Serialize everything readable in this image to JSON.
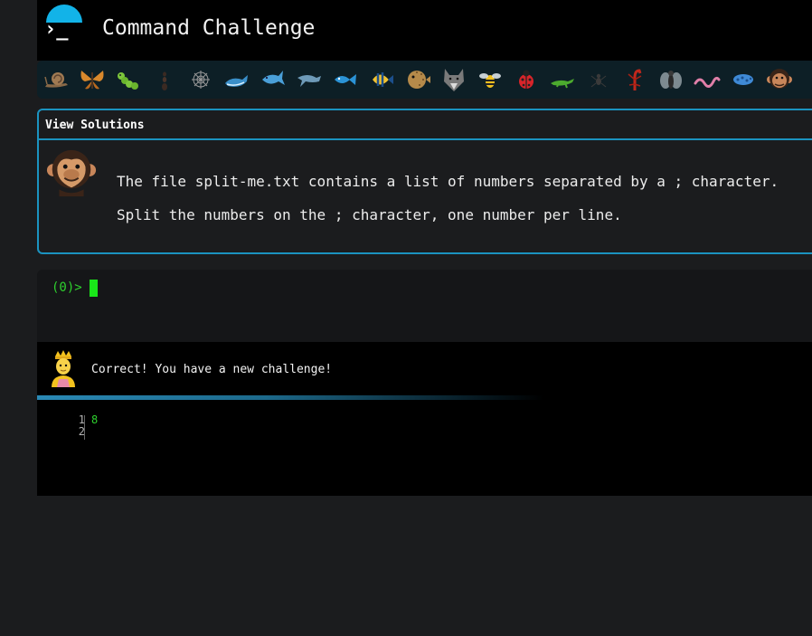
{
  "app": {
    "title": "Command Challenge",
    "logo_glyph": "›_",
    "accent_color": "#1b93c0"
  },
  "animal_bar": {
    "icons": [
      "snail",
      "butterfly",
      "caterpillar",
      "ant",
      "spider-web",
      "whale",
      "shark",
      "dolphin",
      "fish",
      "tropical-fish",
      "blowfish",
      "wolf",
      "bee",
      "ladybug",
      "lizard",
      "spider",
      "scorpion",
      "fly",
      "worm",
      "microbe",
      "chimpanzee"
    ]
  },
  "challenge": {
    "solutions_label": "View Solutions",
    "line1": "The file split-me.txt contains a list of numbers separated by a ; character.",
    "line2": "Split the numbers on the ; character, one number per line."
  },
  "terminal": {
    "prompt": "(0)>"
  },
  "result": {
    "message": "Correct! You have a new challenge!",
    "line_numbers": [
      "1",
      "2"
    ],
    "output_lines": [
      "8"
    ]
  }
}
